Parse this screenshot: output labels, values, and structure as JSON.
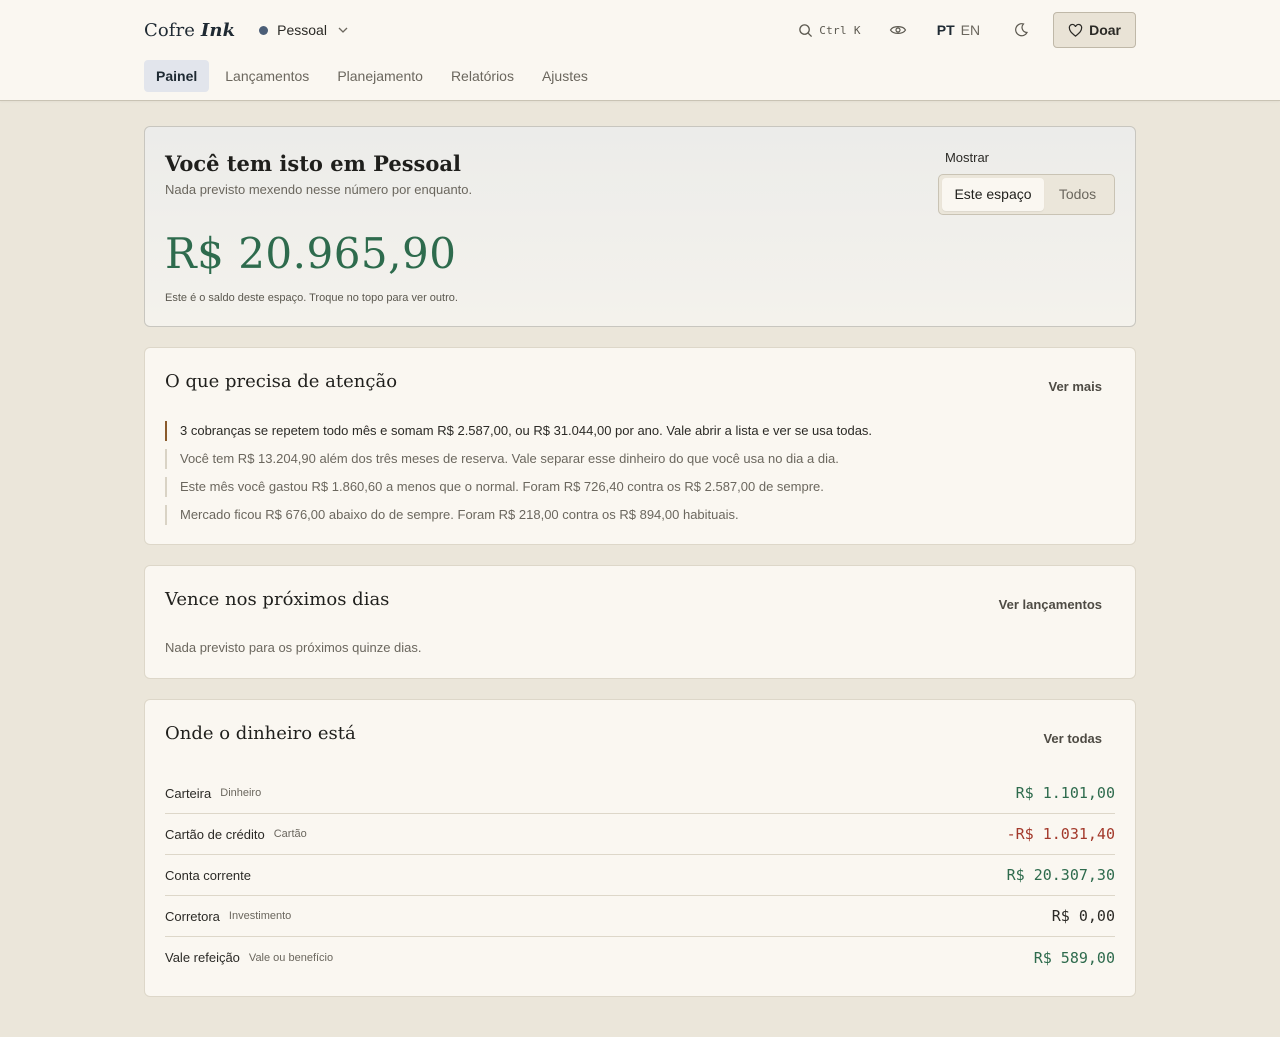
{
  "brand": {
    "name": "Cofre",
    "ink": "Ink"
  },
  "space": {
    "name": "Pessoal",
    "dot_color": "#4b5e77"
  },
  "search": {
    "shortcut": "Ctrl K"
  },
  "lang": {
    "active": "PT",
    "other": "EN"
  },
  "donate": {
    "label": "Doar"
  },
  "nav": {
    "items": [
      {
        "label": "Painel"
      },
      {
        "label": "Lançamentos"
      },
      {
        "label": "Planejamento"
      },
      {
        "label": "Relatórios"
      },
      {
        "label": "Ajustes"
      }
    ]
  },
  "hero": {
    "title": "Você tem isto em Pessoal",
    "subtitle": "Nada previsto mexendo nesse número por enquanto.",
    "amount": "R$ 20.965,90",
    "note": "Este é o saldo deste espaço. Troque no topo para ver outro.",
    "show_label": "Mostrar",
    "option_this": "Este espaço",
    "option_all": "Todos"
  },
  "attention": {
    "title": "O que precisa de atenção",
    "link": "Ver mais",
    "items": [
      "3 cobranças se repetem todo mês e somam R$ 2.587,00, ou R$ 31.044,00 por ano. Vale abrir a lista e ver se usa todas.",
      "Você tem R$ 13.204,90 além dos três meses de reserva. Vale separar esse dinheiro do que você usa no dia a dia.",
      "Este mês você gastou R$ 1.860,60 a menos que o normal. Foram R$ 726,40 contra os R$ 2.587,00 de sempre.",
      "Mercado ficou R$ 676,00 abaixo do de sempre. Foram R$ 218,00 contra os R$ 894,00 habituais."
    ]
  },
  "due": {
    "title": "Vence nos próximos dias",
    "link": "Ver lançamentos",
    "empty": "Nada previsto para os próximos quinze dias."
  },
  "accounts": {
    "title": "Onde o dinheiro está",
    "link": "Ver todas",
    "items": [
      {
        "name": "Carteira",
        "type": "Dinheiro",
        "value": "R$ 1.101,00",
        "sign": "pos"
      },
      {
        "name": "Cartão de crédito",
        "type": "Cartão",
        "value": "-R$ 1.031,40",
        "sign": "neg"
      },
      {
        "name": "Conta corrente",
        "type": "",
        "value": "R$ 20.307,30",
        "sign": "pos"
      },
      {
        "name": "Corretora",
        "type": "Investimento",
        "value": "R$ 0,00",
        "sign": "zero"
      },
      {
        "name": "Vale refeição",
        "type": "Vale ou benefício",
        "value": "R$ 589,00",
        "sign": "pos"
      }
    ]
  },
  "colors": {
    "positive": "#2e6b4d",
    "negative": "#a3392b",
    "accent_bar": "#8a5a2b"
  }
}
